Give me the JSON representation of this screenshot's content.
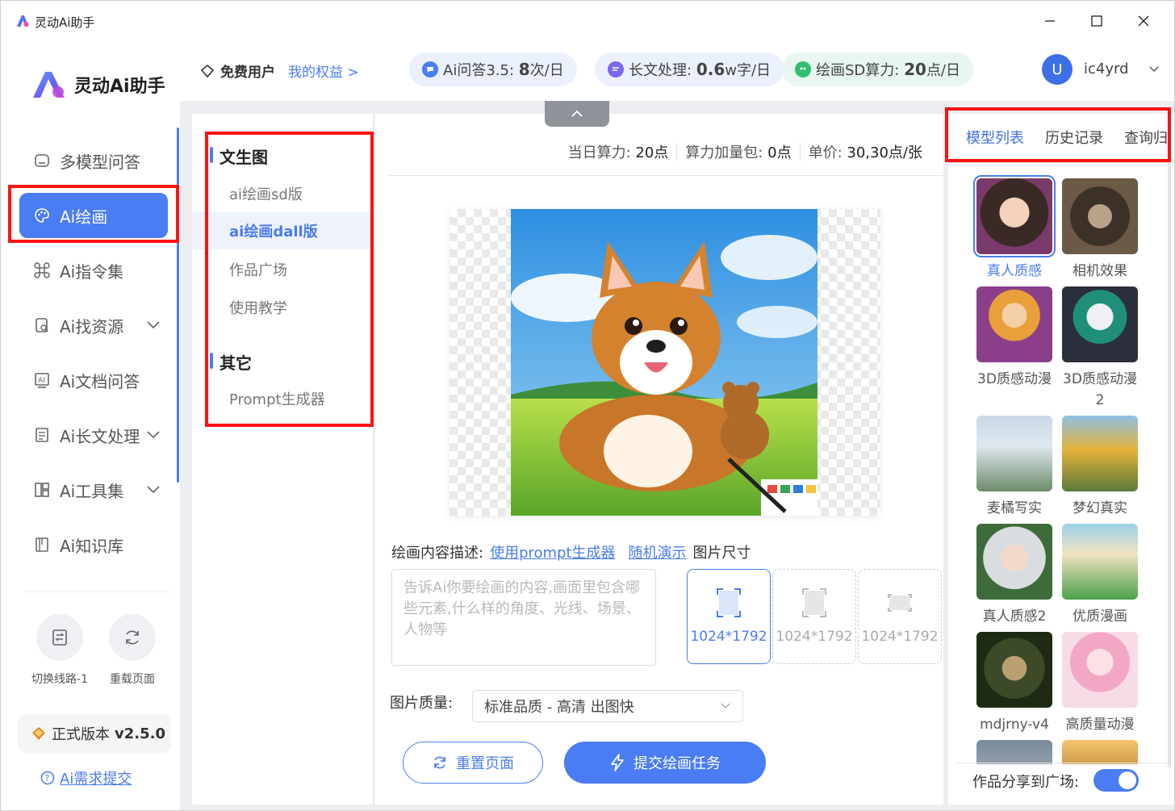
{
  "window": {
    "title": "灵动Ai助手",
    "controls": {
      "minimize": "minimize",
      "maximize": "maximize",
      "close": "close"
    }
  },
  "sidebar": {
    "brand": "灵动Ai助手",
    "items": [
      {
        "label": "多模型问答",
        "icon": "chat-bubble-icon"
      },
      {
        "label": "Ai绘画",
        "icon": "palette-icon",
        "active": true
      },
      {
        "label": "Ai指令集",
        "icon": "command-icon"
      },
      {
        "label": "Ai找资源",
        "icon": "search-doc-icon",
        "expandable": true
      },
      {
        "label": "Ai文档问答",
        "icon": "doc-qa-icon"
      },
      {
        "label": "Ai长文处理",
        "icon": "long-text-icon",
        "expandable": true
      },
      {
        "label": "Ai工具集",
        "icon": "tools-icon",
        "expandable": true
      },
      {
        "label": "Ai知识库",
        "icon": "book-icon"
      }
    ],
    "tools": [
      {
        "label": "切换线路-1",
        "icon": "switch-route-icon"
      },
      {
        "label": "重载页面",
        "icon": "reload-icon"
      }
    ],
    "version_prefix": "正式版本",
    "version": "v2.5.0",
    "feedback": "Ai需求提交"
  },
  "header": {
    "user_type": "免费用户",
    "rights_link": "我的权益 >",
    "pills": [
      {
        "label": "Ai问答3.5:",
        "value": "8",
        "unit": "次/日",
        "color": "#4a7cf3"
      },
      {
        "label": "长文处理:",
        "value": "0.6",
        "unit": "w字/日",
        "color": "#7b68ee"
      },
      {
        "label": "绘画SD算力:",
        "value": "20",
        "unit": "点/日",
        "color": "#2fbf71"
      }
    ],
    "avatar_letter": "U",
    "username": "ic4yrd"
  },
  "subnav": {
    "group1": "文生图",
    "items1": [
      "ai绘画sd版",
      "ai绘画dall版",
      "作品广场",
      "使用教学"
    ],
    "active": "ai绘画dall版",
    "group2": "其它",
    "items2": [
      "Prompt生成器"
    ]
  },
  "main": {
    "stats": {
      "daily_label": "当日算力:",
      "daily_value": "20点",
      "bonus_label": "算力加量包:",
      "bonus_value": "0点",
      "price_label": "单价:",
      "price_value": "30,30点/张"
    },
    "desc_label": "绘画内容描述:",
    "prompt_link": "使用prompt生成器",
    "random_link": "随机演示",
    "size_label": "图片尺寸",
    "prompt_placeholder": "告诉Ai你要绘画的内容,画面里包含哪些元素,什么样的角度、光线、场景、人物等",
    "sizes": [
      {
        "label": "1024*1792",
        "active": true
      },
      {
        "label": "1024*1792",
        "active": false
      },
      {
        "label": "1024*1792",
        "active": false
      }
    ],
    "quality_label": "图片质量:",
    "quality_value": "标准品质 - 高清 出图快",
    "reset_button": "重置页面",
    "submit_button": "提交绘画任务"
  },
  "right_panel": {
    "tabs": [
      "模型列表",
      "历史记录",
      "查询归"
    ],
    "active_tab": "模型列表",
    "models": [
      {
        "name": "真人质感",
        "selected": true
      },
      {
        "name": "相机效果"
      },
      {
        "name": "3D质感动漫"
      },
      {
        "name": "3D质感动漫2"
      },
      {
        "name": "麦橘写实"
      },
      {
        "name": "梦幻真实"
      },
      {
        "name": "真人质感2"
      },
      {
        "name": "优质漫画"
      },
      {
        "name": "mdjrny-v4"
      },
      {
        "name": "高质量动漫"
      }
    ],
    "share_label": "作品分享到广场:",
    "share_enabled": true
  }
}
